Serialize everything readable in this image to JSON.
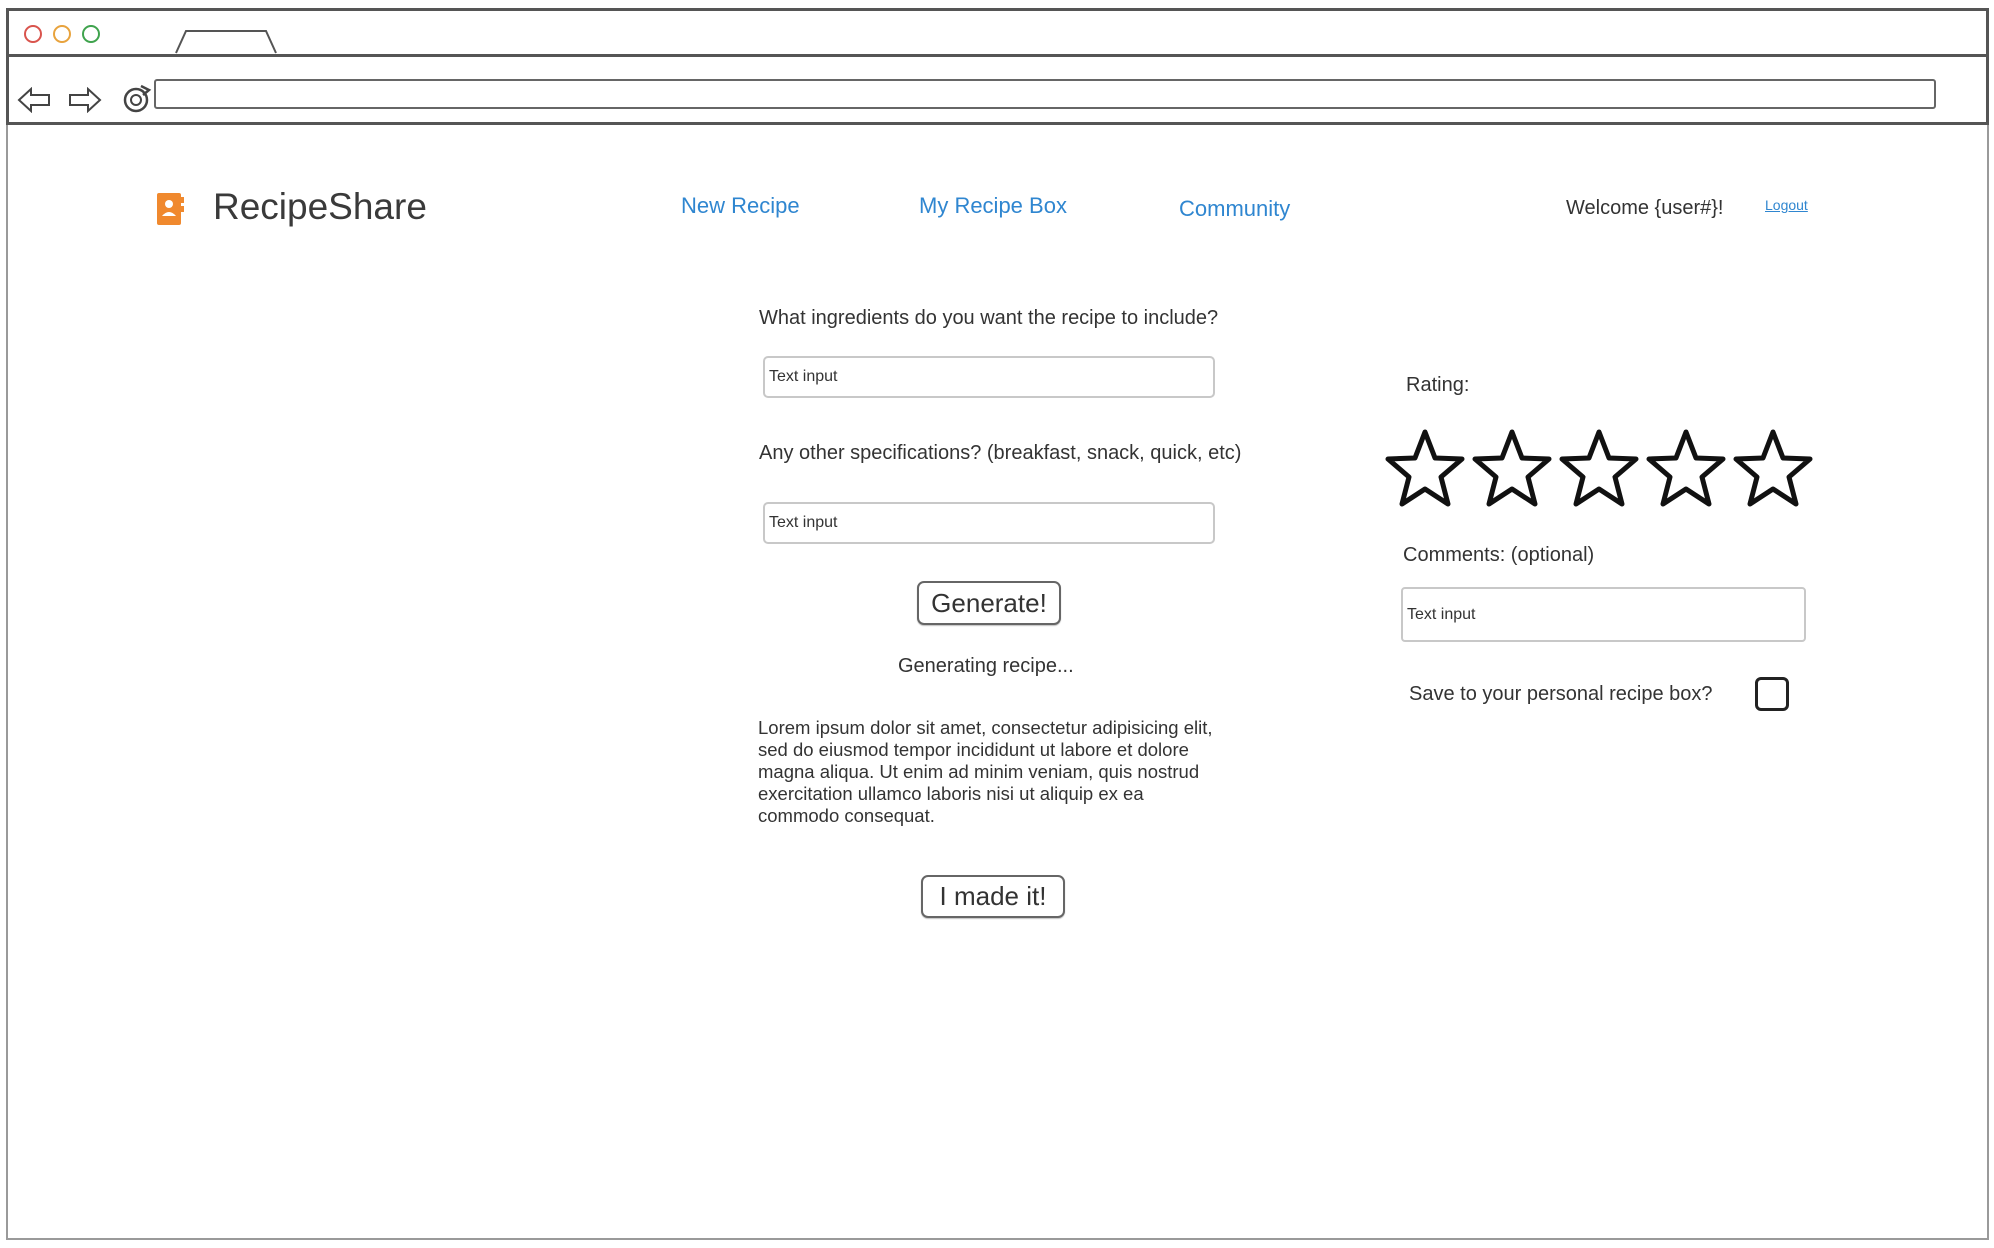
{
  "browser": {
    "window_dots": [
      {
        "name": "close",
        "color": "#d9544d"
      },
      {
        "name": "minimize",
        "color": "#e8a33d"
      },
      {
        "name": "maximize",
        "color": "#3fa34d"
      }
    ],
    "url": ""
  },
  "header": {
    "brand": "RecipeShare",
    "brand_color": "#f0892e",
    "nav": [
      {
        "label": "New Recipe"
      },
      {
        "label": "My Recipe Box"
      },
      {
        "label": "Community"
      }
    ],
    "welcome": "Welcome {user#}!",
    "logout": "Logout"
  },
  "generator": {
    "ingredients_label": "What ingredients do you want the recipe to include?",
    "ingredients_placeholder": "Text input",
    "specs_label": "Any other specifications? (breakfast, snack, quick, etc)",
    "specs_placeholder": "Text input",
    "generate_button": "Generate!",
    "status": "Generating recipe...",
    "recipe_text": "Lorem ipsum dolor sit amet, consectetur adipisicing elit, sed do eiusmod tempor incididunt ut labore et dolore magna aliqua. Ut enim ad minim veniam, quis nostrud exercitation ullamco laboris nisi ut aliquip ex ea commodo consequat.",
    "made_it_button": "I made it!"
  },
  "review": {
    "rating_label": "Rating:",
    "rating_max": 5,
    "rating_value": 0,
    "comments_label": "Comments: (optional)",
    "comments_placeholder": "Text input",
    "save_label": "Save to your personal recipe box?",
    "save_checked": false
  },
  "colors": {
    "link": "#2f86d0",
    "text": "#333333"
  }
}
